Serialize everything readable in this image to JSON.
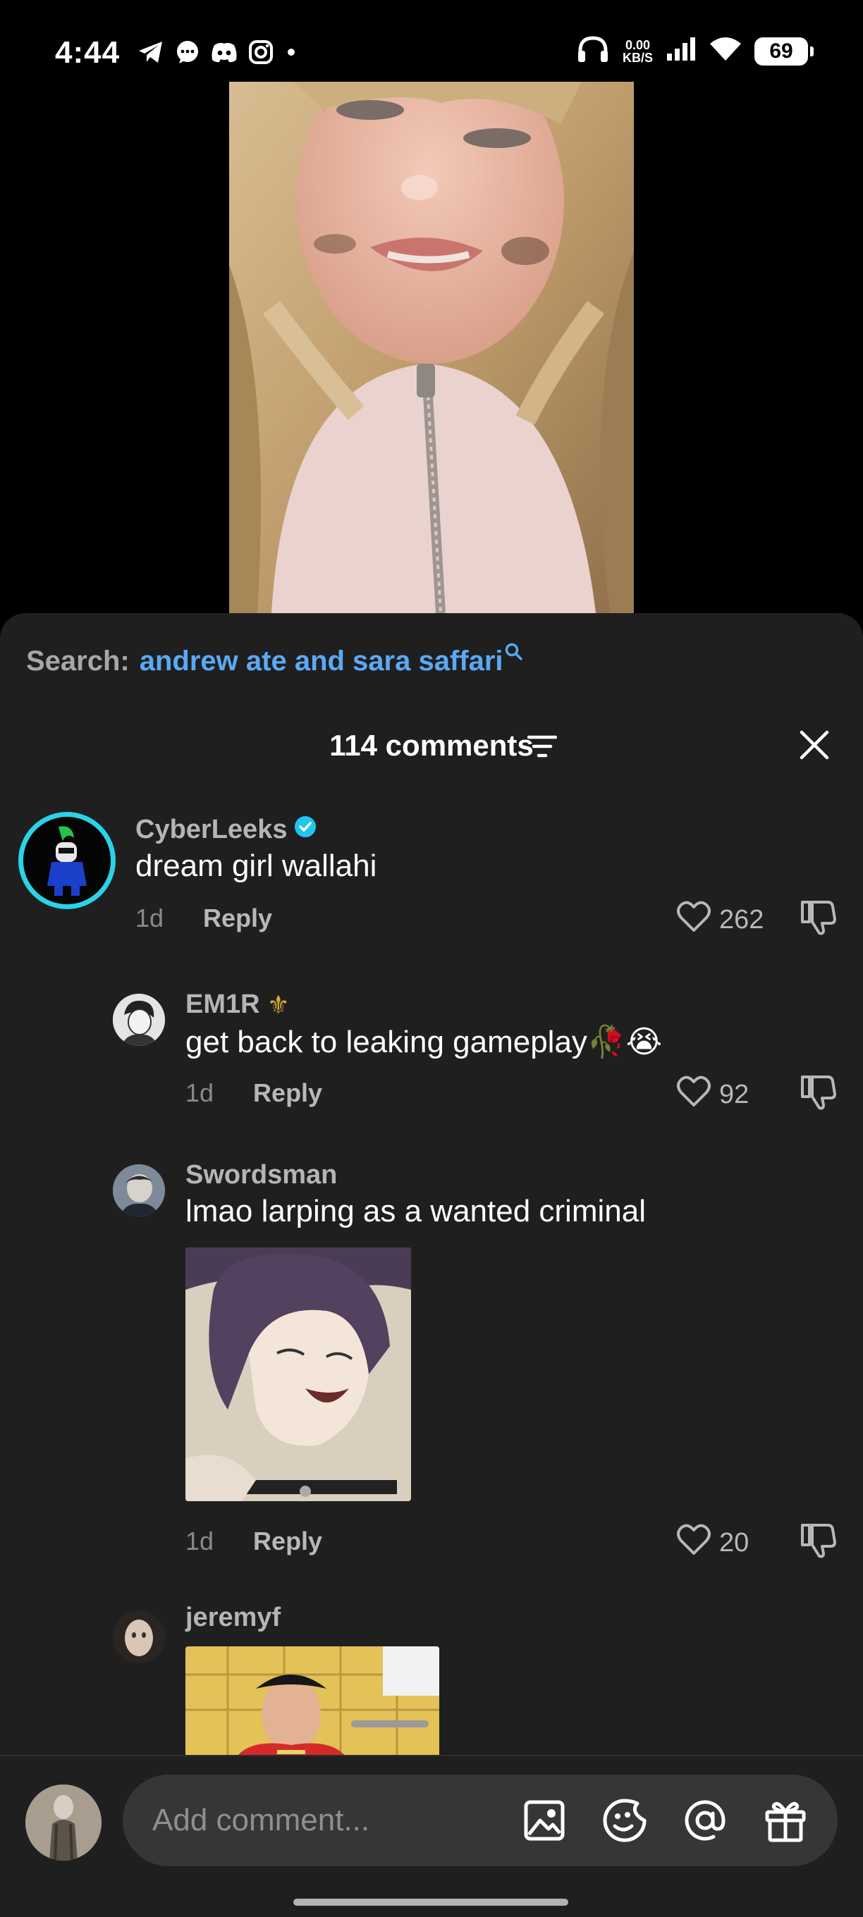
{
  "status_bar": {
    "time": "4:44",
    "net_speed_value": "0.00",
    "net_speed_unit": "KB/S",
    "battery": "69"
  },
  "search": {
    "prefix": "Search:",
    "query": "andrew ate and sara saffari"
  },
  "header": {
    "count_label": "114 comments"
  },
  "comments": [
    {
      "username": "CyberLeeks",
      "verified": true,
      "text": "dream girl wallahi",
      "age": "1d",
      "reply_label": "Reply",
      "likes": "262"
    },
    {
      "username": "EM1R",
      "username_suffix": "⚜",
      "text": "get back to leaking gameplay🥀😭",
      "age": "1d",
      "reply_label": "Reply",
      "likes": "92"
    },
    {
      "username": "Swordsman",
      "text": "lmao larping as a wanted criminal",
      "age": "1d",
      "reply_label": "Reply",
      "likes": "20"
    },
    {
      "username": "jeremyf"
    }
  ],
  "composer": {
    "placeholder": "Add comment..."
  },
  "colors": {
    "sheet_bg": "#1f1f1f",
    "link_blue": "#5aa9f5",
    "verified": "#20c5f0",
    "avatar_ring": "#2ad3e6"
  }
}
